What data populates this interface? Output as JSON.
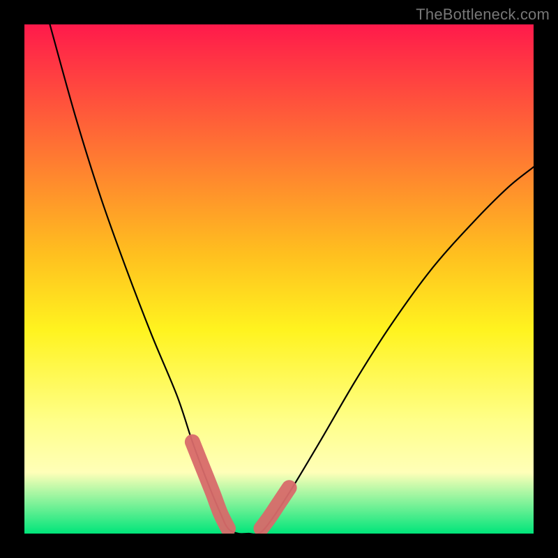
{
  "watermark": "TheBottleneck.com",
  "chart_data": {
    "type": "line",
    "title": "",
    "xlabel": "",
    "ylabel": "",
    "xlim": [
      0,
      100
    ],
    "ylim": [
      0,
      100
    ],
    "background_gradient": {
      "stops": [
        {
          "offset": 0,
          "color": "#ff1a4b"
        },
        {
          "offset": 45,
          "color": "#ffbf1f"
        },
        {
          "offset": 60,
          "color": "#fff31f"
        },
        {
          "offset": 78,
          "color": "#ffff8a"
        },
        {
          "offset": 88,
          "color": "#ffffb8"
        },
        {
          "offset": 100,
          "color": "#00e57a"
        }
      ]
    },
    "series": [
      {
        "name": "bottleneck-curve",
        "x": [
          5,
          10,
          15,
          20,
          25,
          30,
          33,
          36,
          38.5,
          40,
          42,
          44,
          46,
          48,
          52,
          58,
          65,
          72,
          80,
          88,
          95,
          100
        ],
        "y": [
          100,
          82,
          66,
          52,
          39,
          27,
          18,
          10,
          4,
          1,
          0,
          0,
          0,
          2,
          8,
          18,
          30,
          41,
          52,
          61,
          68,
          72
        ]
      }
    ],
    "marker_segments": [
      {
        "name": "left-pink-segment",
        "x": [
          33,
          35,
          37,
          38.5,
          40
        ],
        "y": [
          18,
          13,
          8,
          4,
          1
        ]
      },
      {
        "name": "right-pink-segment",
        "x": [
          46.5,
          48,
          50,
          52
        ],
        "y": [
          1,
          3,
          6,
          9
        ]
      }
    ],
    "curve_color": "#000000",
    "marker_color": "#d86a6a",
    "grid": false,
    "legend": false
  }
}
